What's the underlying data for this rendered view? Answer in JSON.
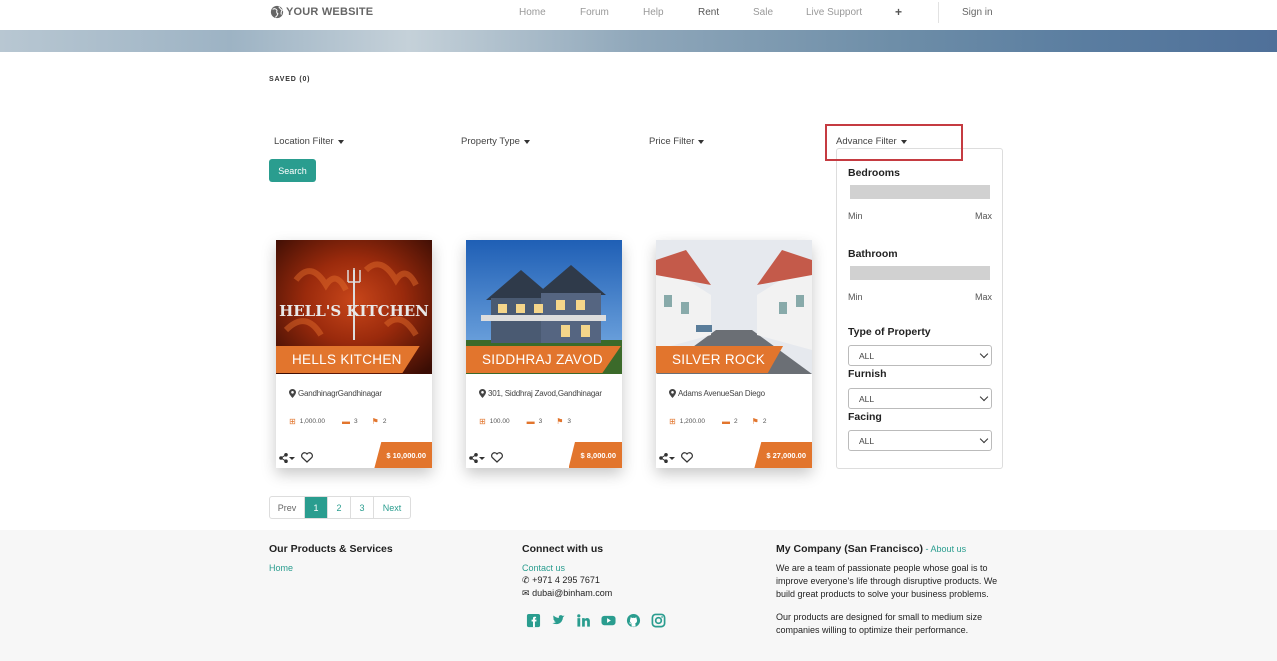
{
  "nav": {
    "logo": "YOUR WEBSITE",
    "links": [
      "Home",
      "Forum",
      "Help",
      "Rent",
      "Sale",
      "Live Support"
    ],
    "plus": "+",
    "signin": "Sign in"
  },
  "saved": "SAVED (0)",
  "filters": {
    "location": "Location Filter",
    "property_type": "Property Type",
    "price": "Price Filter",
    "advance": "Advance Filter",
    "search": "Search"
  },
  "advance_panel": {
    "bedrooms": "Bedrooms",
    "bathroom": "Bathroom",
    "min": "Min",
    "max": "Max",
    "type_of_property": "Type of Property",
    "furnish": "Furnish",
    "facing": "Facing",
    "type_value": "ALL",
    "furnish_value": "ALL",
    "facing_value": "ALL"
  },
  "listings": [
    {
      "title": "HELLS KITCHEN",
      "location": "GandhinagrGandhinagar",
      "area": "1,000.00",
      "beds": "3",
      "baths": "2",
      "price": "$ 10,000.00"
    },
    {
      "title": "SIDDHRAJ ZAVOD",
      "location": "301, Siddhraj Zavod,Gandhinagar",
      "area": "100.00",
      "beds": "3",
      "baths": "3",
      "price": "$ 8,000.00"
    },
    {
      "title": "SILVER ROCK",
      "location": "Adams AvenueSan Diego",
      "area": "1,200.00",
      "beds": "2",
      "baths": "2",
      "price": "$ 27,000.00"
    }
  ],
  "pagination": {
    "prev": "Prev",
    "pages": [
      "1",
      "2",
      "3"
    ],
    "next": "Next"
  },
  "footer": {
    "products_title": "Our Products & Services",
    "home": "Home",
    "connect_title": "Connect with us",
    "contact": "Contact us",
    "phone": "+971 4 295 7671",
    "email": "dubai@binham.com",
    "company_title": "My Company (San Francisco)",
    "about_sep": " - ",
    "about": "About us",
    "desc1_l1": "We are a team of passionate people whose goal is to",
    "desc1_l2": "improve everyone's life through disruptive products. We",
    "desc1_l3": "build great products to solve your business problems.",
    "desc2_l1": "Our products are designed for small to medium size",
    "desc2_l2": "companies willing to optimize their performance."
  },
  "colors": {
    "accent": "#2a9d8f",
    "orange": "#e2752d",
    "highlight": "#c53b41"
  }
}
